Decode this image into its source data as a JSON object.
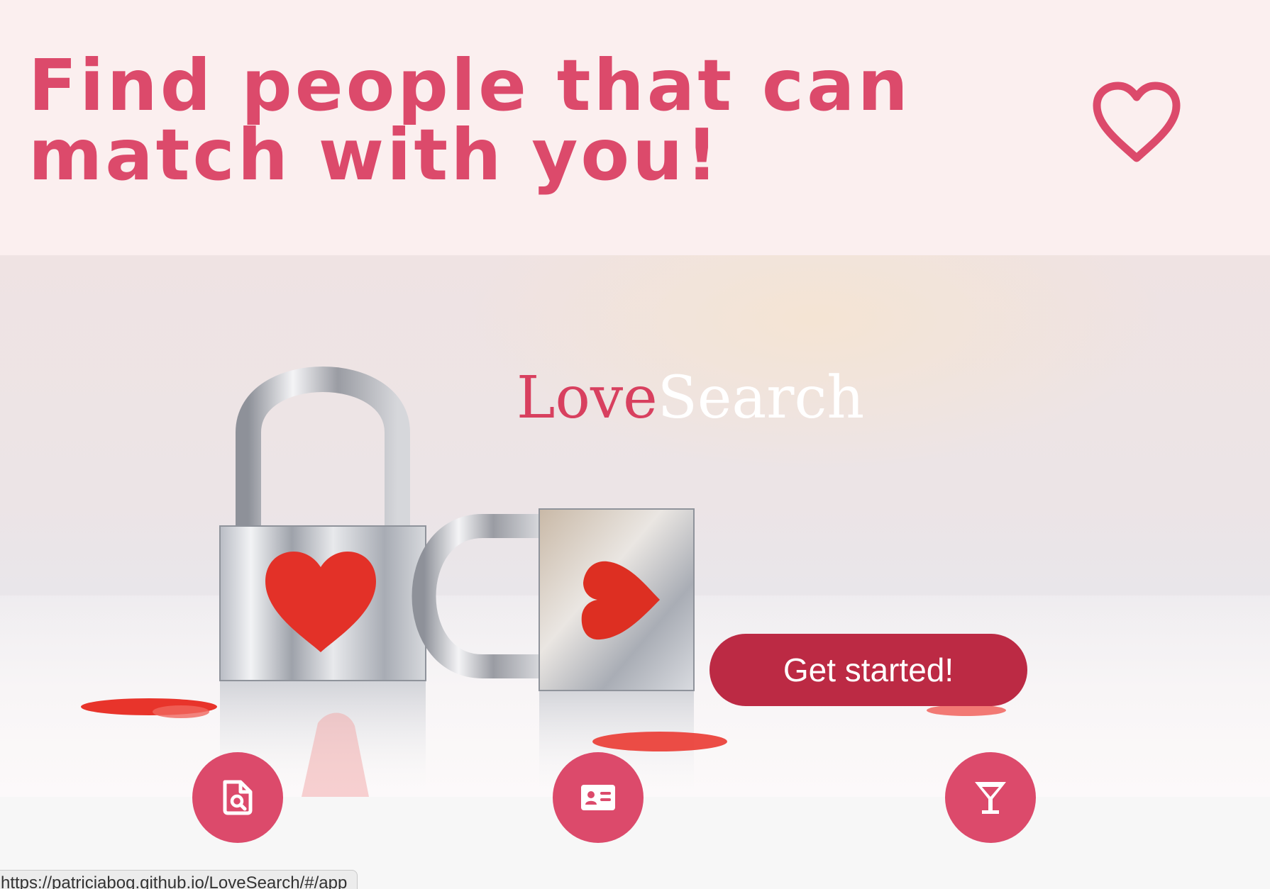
{
  "header": {
    "headline": "Find people that can match with you!",
    "favorite_icon": "heart-outline-icon"
  },
  "hero": {
    "logo": {
      "part1": "Love",
      "part2": "Search"
    },
    "cta_label": "Get started!"
  },
  "features": [
    {
      "icon": "file-search-icon"
    },
    {
      "icon": "id-card-icon"
    },
    {
      "icon": "cocktail-glass-icon"
    }
  ],
  "status_bar": {
    "url": "https://patriciabog.github.io/LoveSearch/#/app"
  },
  "colors": {
    "accent": "#dc4a6b",
    "header_bg": "#fbefef",
    "cta_bg": "#bc2a44",
    "logo_love": "#d8405f",
    "logo_search": "#ffffff"
  }
}
